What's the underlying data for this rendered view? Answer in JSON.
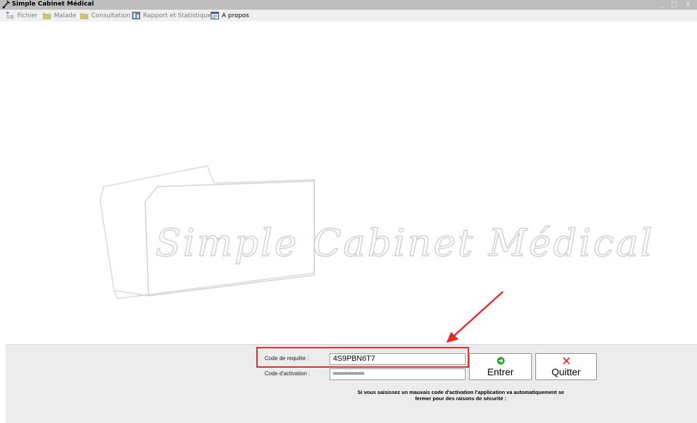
{
  "window": {
    "title": "Simple Cabinet Médical",
    "controls": [
      "_",
      "□",
      "X"
    ]
  },
  "menu": [
    {
      "label": "Fichier",
      "icon": "tree-icon"
    },
    {
      "label": "Malade",
      "icon": "folder-icon"
    },
    {
      "label": "Consultation",
      "icon": "folder-icon"
    },
    {
      "label": "Rapport et Statistiques",
      "icon": "report-icon"
    },
    {
      "label": "A propos",
      "icon": "about-icon"
    }
  ],
  "logo": {
    "text": "Simple Cabinet Médical"
  },
  "activation": {
    "request_label": "Code de requête :",
    "request_value": "4S9PBN6T7",
    "activation_label": "Code d'activation :",
    "activation_value": "xxxxxxxxxxxxxxxxxx",
    "enter_label": "Entrer",
    "quit_label": "Quitter",
    "warning_line1": "Si vous saisissez un mauvais code d'activation l'application va automatiquement se",
    "warning_line2": "fermer pour des raisons de sécurité :"
  },
  "colors": {
    "highlight": "#e32a2a",
    "enter_icon": "#2e9e2e",
    "quit_icon": "#d92020"
  }
}
